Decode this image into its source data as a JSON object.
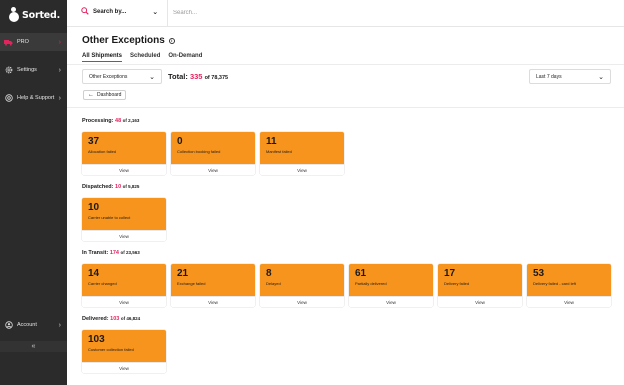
{
  "app": {
    "logo_text": "Sorted."
  },
  "sidebar": {
    "items": [
      {
        "label": "PRO",
        "icon": "truck-icon"
      },
      {
        "label": "Settings",
        "icon": "gear-icon"
      },
      {
        "label": "Help & Support",
        "icon": "help-icon"
      },
      {
        "label": "Account",
        "icon": "user-icon"
      }
    ],
    "collapse_label": "«"
  },
  "topbar": {
    "search_by_label": "Search by...",
    "search_placeholder": "Search..."
  },
  "page": {
    "title": "Other Exceptions",
    "tabs": [
      {
        "label": "All Shipments",
        "active": true
      },
      {
        "label": "Scheduled",
        "active": false
      },
      {
        "label": "On-Demand",
        "active": false
      }
    ],
    "filter_value": "Other Exceptions",
    "total_label": "Total:",
    "total_count": "335",
    "total_of": "of 78,375",
    "date_range": "Last 7 days",
    "dashboard_button": "Dashboard"
  },
  "sections": [
    {
      "title": "Processing:",
      "count": "48",
      "of": "of 2,163",
      "cards": [
        {
          "value": "37",
          "label": "Allocation failed",
          "view": "View"
        },
        {
          "value": "0",
          "label": "Collection booking failed",
          "view": "View"
        },
        {
          "value": "11",
          "label": "Manifest failed",
          "view": "View"
        }
      ]
    },
    {
      "title": "Dispatched:",
      "count": "10",
      "of": "of 5,825",
      "cards": [
        {
          "value": "10",
          "label": "Carrier unable to collect",
          "view": "View"
        }
      ]
    },
    {
      "title": "In Transit:",
      "count": "174",
      "of": "of 23,563",
      "cards": [
        {
          "value": "14",
          "label": "Carrier changed",
          "view": "View"
        },
        {
          "value": "21",
          "label": "Exchange failed",
          "view": "View"
        },
        {
          "value": "8",
          "label": "Delayed",
          "view": "View"
        },
        {
          "value": "61",
          "label": "Partially delivered",
          "view": "View"
        },
        {
          "value": "17",
          "label": "Delivery failed",
          "view": "View"
        },
        {
          "value": "53",
          "label": "Delivery failed - card left",
          "view": "View"
        }
      ]
    },
    {
      "title": "Delivered:",
      "count": "103",
      "of": "of 46,824",
      "cards": [
        {
          "value": "103",
          "label": "Customer collection failed",
          "view": "View"
        }
      ]
    }
  ],
  "colors": {
    "accent": "#e0245e",
    "card": "#f7941d",
    "sidebar": "#2b2b2b"
  }
}
